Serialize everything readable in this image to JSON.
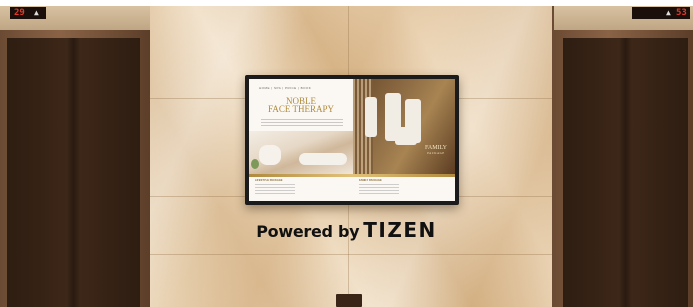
{
  "elevator_left": {
    "floor": "29",
    "arrow": "▲"
  },
  "elevator_right": {
    "floor": "53",
    "arrow": "▲"
  },
  "screen": {
    "nav": "HOME | SPA | PRICE | BOOK",
    "noble_title_line1": "NOBLE",
    "noble_title_line2": "FACE THERAPY",
    "family_title_line1": "FAMILY",
    "family_title_line2": "PACKAGE",
    "footer_left_heading": "LIFESTYLE PACKAGE",
    "footer_right_heading": "FAMILY PACKAGE"
  },
  "branding": {
    "powered_by": "Powered by",
    "brand": "TIZEN"
  },
  "colors": {
    "gold": "#b08a3e",
    "marble": "#e5cba6",
    "wood": "#3d2718",
    "display_red": "#e03a2a"
  }
}
